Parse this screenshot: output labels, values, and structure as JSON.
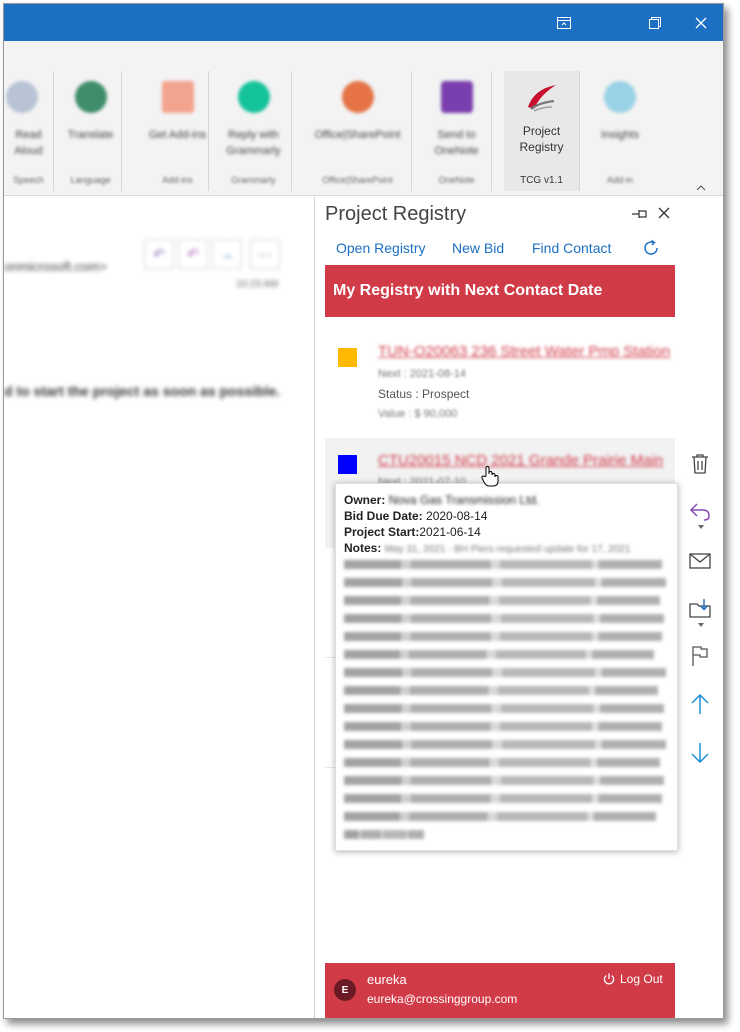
{
  "titlebar": {
    "controls": [
      "restore-window",
      "restore",
      "close"
    ]
  },
  "ribbon": {
    "groups": [
      {
        "label": "Read Aloud",
        "group": "Speech"
      },
      {
        "label": "Translate",
        "group": "Language"
      },
      {
        "label": "Get Add-ins",
        "group": "Add-ins"
      },
      {
        "label": "Reply with Grammarly",
        "group": "Grammarly"
      },
      {
        "label": "Office|SharePoint",
        "group": "Office|SharePoint"
      },
      {
        "label": "Send to OneNote",
        "group": "OneNote"
      },
      {
        "label": "Project Registry",
        "group": "TCG v1.1"
      },
      {
        "label": "Insights",
        "group": "Add-in"
      }
    ],
    "tcg_label_1": "Project",
    "tcg_label_2": "Registry",
    "tcg_group": "TCG v1.1"
  },
  "email": {
    "sender_fragment": "onmicrosoft.com>",
    "time": "10:23 AM",
    "body_fragment": "d to start the project as soon as possible."
  },
  "pane": {
    "title": "Project Registry",
    "toolbar": {
      "open_registry": "Open Registry",
      "new_bid": "New Bid",
      "find_contact": "Find Contact"
    },
    "banner": "My Registry with Next Contact Date",
    "entries": [
      {
        "title": "TUN-O20063 236 Street Water Pmp Station",
        "next": "Next : 2021-08-14",
        "status": "Status : Prospect",
        "value": "Value : $ 90,000",
        "color": "#ffb900"
      },
      {
        "title": "CTU20015 NCD 2021 Grande Prairie Main",
        "next": "Next : 2021-07-10",
        "color": "#0000ff"
      }
    ],
    "tooltip": {
      "owner_label": "Owner:",
      "owner_value": "Nova Gas Transmission Ltd.",
      "bid_due_label": "Bid Due Date:",
      "bid_due_value": "2020-08-14",
      "start_label": "Project Start:",
      "start_value": "2021-06-14",
      "notes_label": "Notes:",
      "notes_value": "May 31, 2021 - BH Piers requested update for 17, 2021"
    },
    "footer": {
      "avatar_initial": "E",
      "user_name": "eureka",
      "user_email": "eureka@crossinggroup.com",
      "logout": "Log Out"
    }
  },
  "colors": {
    "accent": "#d13b48",
    "titlebar": "#1c6fc3",
    "link": "#1c6fc3"
  }
}
